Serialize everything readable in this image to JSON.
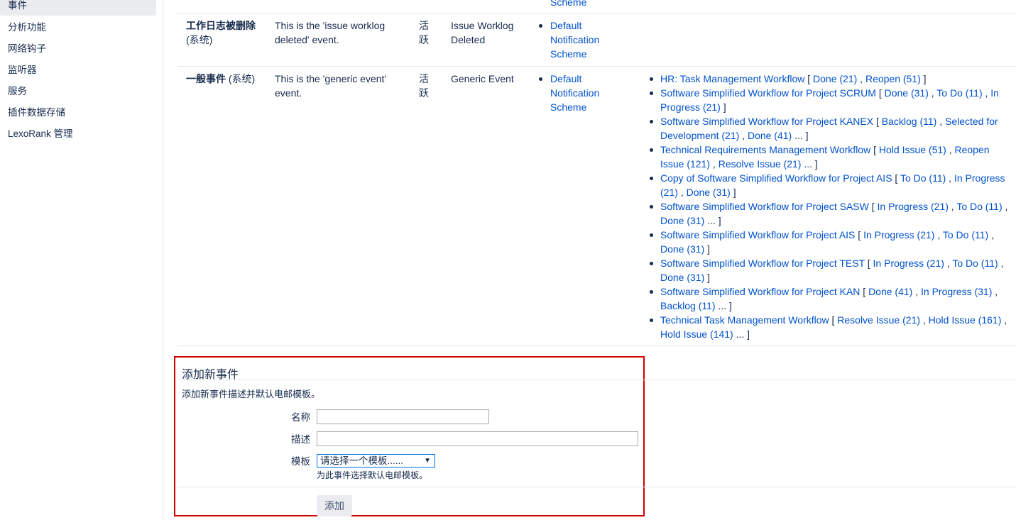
{
  "sidebar": {
    "items": [
      {
        "label": "事件",
        "active": true
      },
      {
        "label": "分析功能"
      },
      {
        "label": "网络钩子"
      },
      {
        "label": "监听器"
      },
      {
        "label": "服务"
      },
      {
        "label": "插件数据存储"
      },
      {
        "label": "LexoRank 管理"
      }
    ]
  },
  "events": {
    "prev_row_tail": "Scheme",
    "worklog_deleted": {
      "name": "工作日志被删除",
      "system_tag": "(系统)",
      "description": "This is the 'issue worklog deleted' event.",
      "status_line1": "活",
      "status_line2": "跃",
      "template": "Issue Worklog Deleted",
      "scheme": "Default Notification Scheme"
    },
    "generic": {
      "name": "一般事件",
      "system_tag": "(系统)",
      "description": "This is the 'generic event' event.",
      "status_line1": "活",
      "status_line2": "跃",
      "template": "Generic Event",
      "scheme": "Default Notification Scheme",
      "workflows": [
        {
          "name": "HR: Task Management Workflow",
          "transitions": [
            "Done (21)",
            "Reopen (51)"
          ],
          "more": false
        },
        {
          "name": "Software Simplified Workflow for Project SCRUM",
          "transitions": [
            "Done (31)",
            "To Do (11)",
            "In Progress (21)"
          ],
          "more": false
        },
        {
          "name": "Software Simplified Workflow for Project KANEX",
          "transitions": [
            "Backlog (11)",
            "Selected for Development (21)",
            "Done (41)"
          ],
          "more": true
        },
        {
          "name": "Technical Requirements Management Workflow",
          "transitions": [
            "Hold Issue (51)",
            "Reopen Issue (121)",
            "Resolve Issue (21)"
          ],
          "more": true
        },
        {
          "name": "Copy of Software Simplified Workflow for Project AIS",
          "transitions": [
            "To Do (11)",
            "In Progress (21)",
            "Done (31)"
          ],
          "more": false
        },
        {
          "name": "Software Simplified Workflow for Project SASW",
          "transitions": [
            "In Progress (21)",
            "To Do (11)",
            "Done (31)"
          ],
          "more": true
        },
        {
          "name": "Software Simplified Workflow for Project AIS",
          "transitions": [
            "In Progress (21)",
            "To Do (11)",
            "Done (31)"
          ],
          "more": false
        },
        {
          "name": "Software Simplified Workflow for Project TEST",
          "transitions": [
            "In Progress (21)",
            "To Do (11)",
            "Done (31)"
          ],
          "more": false
        },
        {
          "name": "Software Simplified Workflow for Project KAN",
          "transitions": [
            "Done (41)",
            "In Progress (31)",
            "Backlog (11)"
          ],
          "more": true
        },
        {
          "name": "Technical Task Management Workflow",
          "transitions": [
            "Resolve Issue (21)",
            "Hold Issue (161)",
            "Hold Issue (141)"
          ],
          "more": true
        }
      ]
    }
  },
  "add_event": {
    "title": "添加新事件",
    "description": "添加新事件描述并默认电邮模板。",
    "name_label": "名称",
    "name_value": "",
    "desc_label": "描述",
    "desc_value": "",
    "template_label": "模板",
    "template_selected": "请选择一个模板......",
    "template_hint": "为此事件选择默认电邮模板。",
    "submit_label": "添加"
  },
  "colors": {
    "link": "#0052cc",
    "text": "#172b4d",
    "highlight_border": "#d00000",
    "active_nav_bg": "#ebecf0"
  }
}
